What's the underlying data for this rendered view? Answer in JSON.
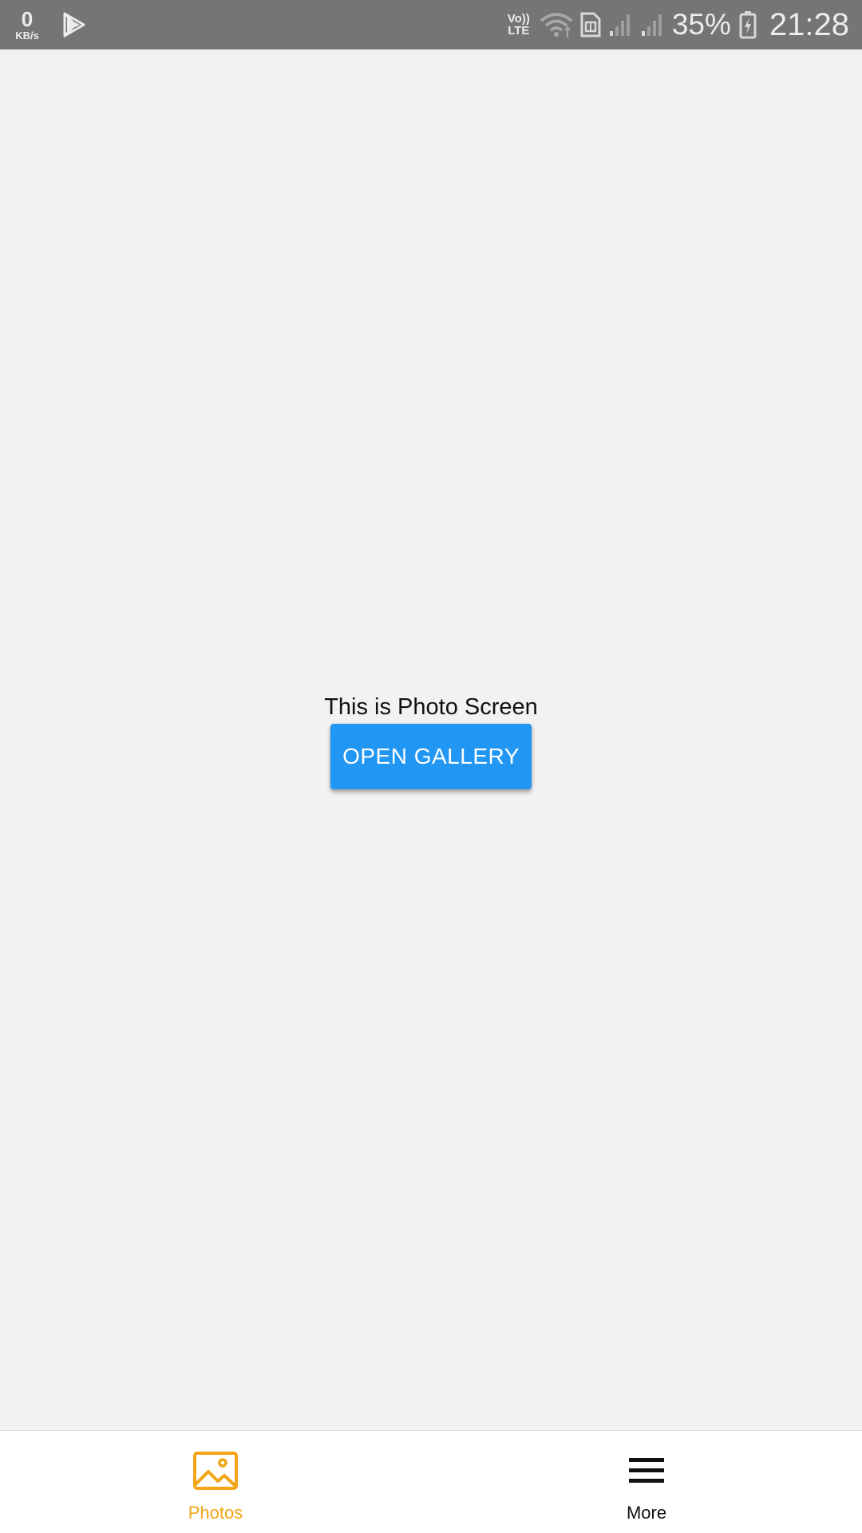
{
  "status_bar": {
    "net_speed_value": "0",
    "net_speed_unit": "KB/s",
    "volte_top": "Vo))",
    "volte_bottom": "LTE",
    "battery_percent": "35%",
    "time": "21:28",
    "icons": [
      "play-store-icon",
      "wifi-icon",
      "sim-icon",
      "signal-1-icon",
      "signal-2-icon",
      "battery-charging-icon"
    ]
  },
  "main": {
    "screen_text": "This is Photo Screen",
    "open_gallery_label": "OPEN GALLERY"
  },
  "bottom_nav": {
    "items": [
      {
        "label": "Photos",
        "icon": "image-icon",
        "active": true
      },
      {
        "label": "More",
        "icon": "menu-icon",
        "active": false
      }
    ]
  },
  "colors": {
    "status_bar": "#757575",
    "background": "#f2f2f2",
    "button": "#2196f3",
    "active_tab": "#f2a516"
  }
}
